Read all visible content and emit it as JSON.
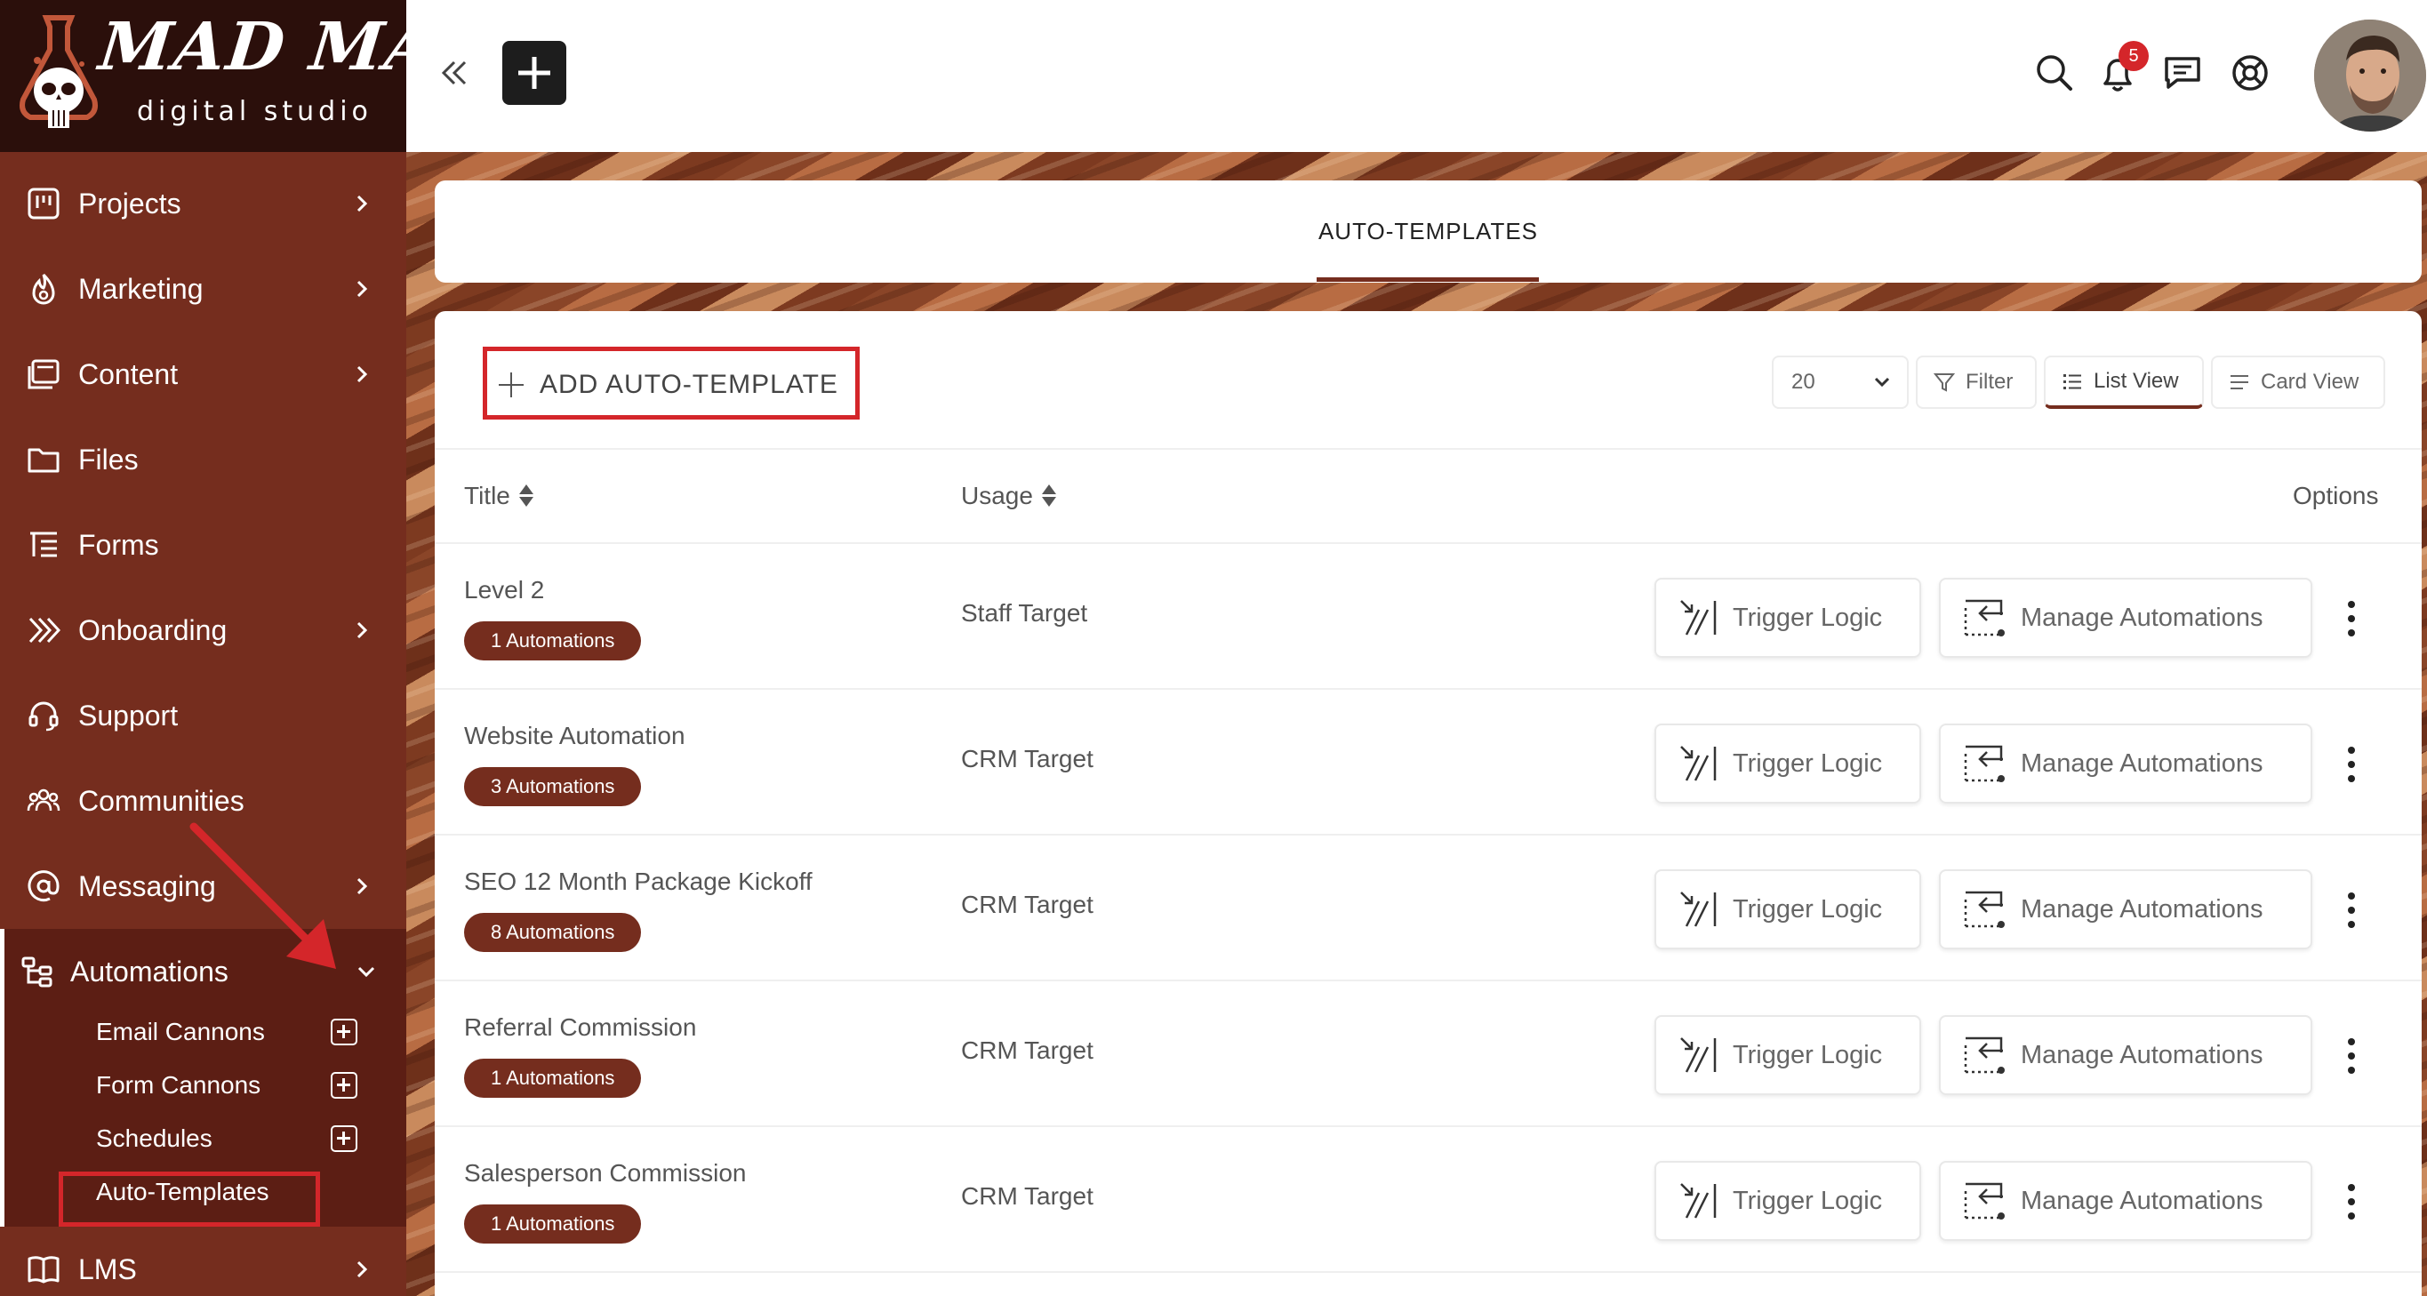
{
  "brand": {
    "title": "MAD MAX",
    "subtitle": "digital studio"
  },
  "sidebar": {
    "items": [
      {
        "label": "Projects",
        "icon": "kanban-icon",
        "has_chevron": true
      },
      {
        "label": "Marketing",
        "icon": "flame-icon",
        "has_chevron": true
      },
      {
        "label": "Content",
        "icon": "content-icon",
        "has_chevron": true
      },
      {
        "label": "Files",
        "icon": "folder-icon",
        "has_chevron": false
      },
      {
        "label": "Forms",
        "icon": "form-list-icon",
        "has_chevron": false
      },
      {
        "label": "Onboarding",
        "icon": "double-chevron-icon",
        "has_chevron": true
      },
      {
        "label": "Support",
        "icon": "headset-icon",
        "has_chevron": false
      },
      {
        "label": "Communities",
        "icon": "people-icon",
        "has_chevron": false
      },
      {
        "label": "Messaging",
        "icon": "at-sign-icon",
        "has_chevron": true
      },
      {
        "label": "Automations",
        "icon": "sitemap-icon",
        "has_chevron": true,
        "expanded": true
      },
      {
        "label": "LMS",
        "icon": "book-icon",
        "has_chevron": true
      }
    ],
    "sub_items": [
      {
        "label": "Email Cannons",
        "has_add": true
      },
      {
        "label": "Form Cannons",
        "has_add": true
      },
      {
        "label": "Schedules",
        "has_add": true
      },
      {
        "label": "Auto-Templates",
        "has_add": false,
        "active": true
      }
    ]
  },
  "topbar": {
    "notification_count": "5",
    "icons": [
      "collapse-icon",
      "plus-icon",
      "search-icon",
      "bell-icon",
      "chat-icon",
      "lifebuoy-icon"
    ]
  },
  "tabs": [
    {
      "label": "AUTO-TEMPLATES",
      "active": true
    }
  ],
  "toolbar": {
    "add_label": "ADD AUTO-TEMPLATE",
    "page_size": "20",
    "filter_label": "Filter",
    "list_view_label": "List View",
    "card_view_label": "Card View"
  },
  "table": {
    "columns": {
      "title": "Title",
      "usage": "Usage",
      "options": "Options"
    },
    "rows": [
      {
        "title": "Level 2",
        "automations": "1 Automations",
        "usage": "Staff Target"
      },
      {
        "title": "Website Automation",
        "automations": "3 Automations",
        "usage": "CRM Target"
      },
      {
        "title": "SEO 12 Month Package Kickoff",
        "automations": "8 Automations",
        "usage": "CRM Target"
      },
      {
        "title": "Referral Commission",
        "automations": "1 Automations",
        "usage": "CRM Target"
      },
      {
        "title": "Salesperson Commission",
        "automations": "1 Automations",
        "usage": "CRM Target"
      }
    ],
    "trigger_label": "Trigger Logic",
    "manage_label": "Manage Automations"
  },
  "colors": {
    "sidebar": "#752d1e",
    "sidebar_active": "#5c1e14",
    "logo_bg": "#2b0f0b",
    "accent": "#752d1e",
    "annotation_red": "#d4262a",
    "badge": "#d4262a"
  }
}
